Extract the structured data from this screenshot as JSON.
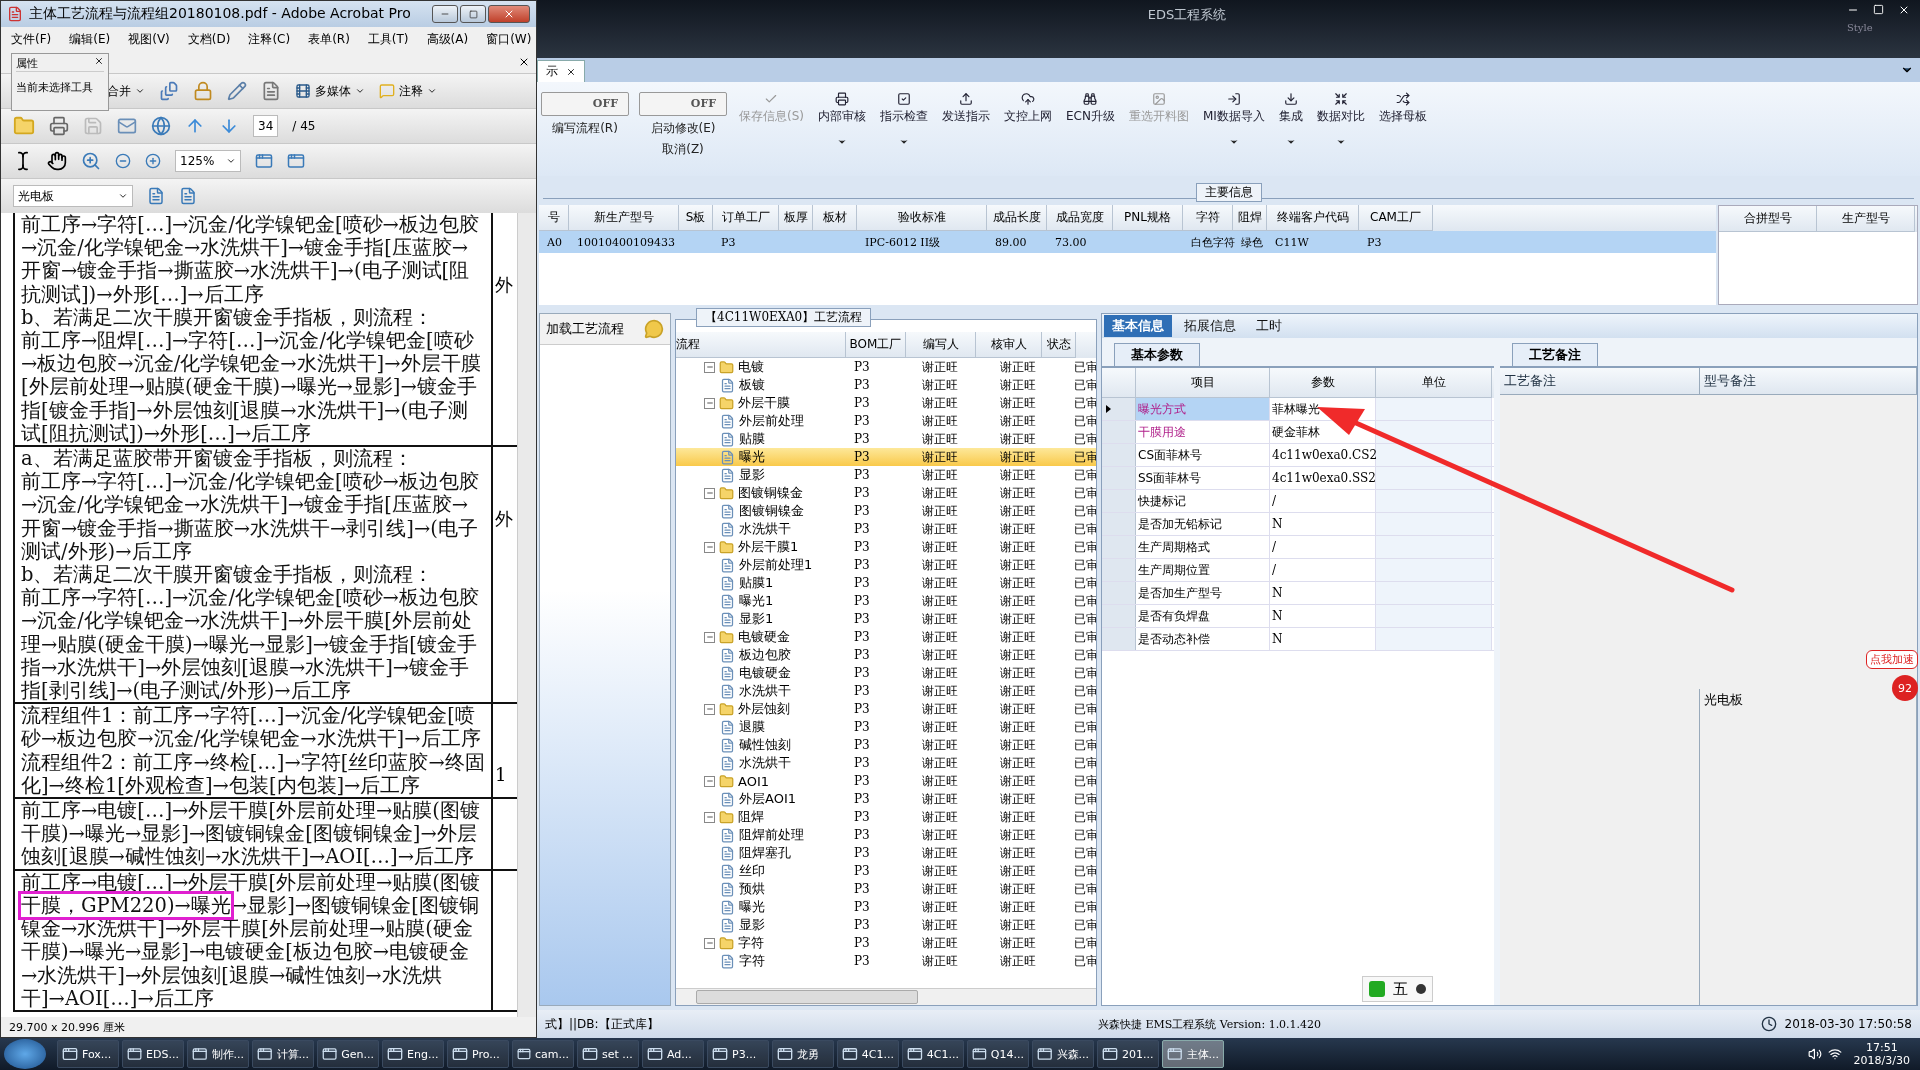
{
  "acrobat": {
    "title": "主体工艺流程与流程组20180108.pdf - Adobe Acrobat Pro",
    "menu": [
      "文件(F)",
      "编辑(E)",
      "视图(V)",
      "文档(D)",
      "注释(C)",
      "表单(R)",
      "工具(T)",
      "高级(A)",
      "窗口(W)"
    ],
    "properties_popup": {
      "title": "属性",
      "text": "当前未选择工具"
    },
    "toolbar_labels": [
      "合并",
      "多媒体",
      "注释"
    ],
    "page": {
      "current": "34",
      "total": "/ 45"
    },
    "zoom": "125%",
    "bookmark_field": "光电板",
    "document_rows": [
      {
        "paragraphs": [
          [
            {
              "text": "前工序→字符[…]→沉金/化学镍钯金[喷砂→板边包胶→沉金/化学镍钯金→水洗烘干]→镀金手指[压蓝胶→开窗→镀金手指→撕蓝胶→水洗烘干]→(电子测试[阻抗测试])→外形[…]→后工序",
              "highlighted": false
            }
          ],
          [
            {
              "text": "b、若满足二次干膜开窗镀金手指板，则流程：",
              "highlighted": false
            }
          ],
          [
            {
              "text": "前工序→阻焊[…]→字符[…]→沉金/化学镍钯金[喷砂→板边包胶→沉金/化学镍钯金→水洗烘干]→外层干膜[外层前处理→贴膜(硬金干膜)→曝光→显影]→镀金手指[镀金手指]→外层蚀刻[退膜→水洗烘干]→(电子测试[阻抗测试])→外形[…]→后工序",
              "highlighted": false
            }
          ]
        ],
        "column_2": "外"
      },
      {
        "paragraphs": [
          [
            {
              "text": "a、若满足蓝胶带开窗镀金手指板，则流程：",
              "highlighted": false
            }
          ],
          [
            {
              "text": "前工序→字符[…]→沉金/化学镍钯金[喷砂→板边包胶→沉金/化学镍钯金→水洗烘干]→镀金手指[压蓝胶→开窗→镀金手指→撕蓝胶→水洗烘干→剥引线]→(电子测试/外形)→后工序",
              "highlighted": false
            }
          ],
          [
            {
              "text": "b、若满足二次干膜开窗镀金手指板，则流程：",
              "highlighted": false
            }
          ],
          [
            {
              "text": "前工序→字符[…]→沉金/化学镍钯金[喷砂→板边包胶→沉金/化学镍钯金→水洗烘干]→外层干膜[外层前处理→贴膜(硬金干膜)→曝光→显影]→镀金手指[镀金手指→水洗烘干]→外层蚀刻[退膜→水洗烘干]→镀金手指[剥引线]→(电子测试/外形)→后工序",
              "highlighted": false
            }
          ]
        ],
        "column_2": "外"
      },
      {
        "paragraphs": [
          [
            {
              "text": "流程组件1：前工序→字符[…]→沉金/化学镍钯金[喷砂→板边包胶→沉金/化学镍钯金→水洗烘干]→后工序",
              "highlighted": false
            }
          ],
          [
            {
              "text": "流程组件2：前工序→终检[…]→字符[丝印蓝胶→终固化]→终检1[外观检查]→包装[内包装]→后工序",
              "highlighted": false
            }
          ]
        ],
        "column_2": "1"
      },
      {
        "paragraphs": [
          [
            {
              "text": "前工序→电镀[…]→外层干膜[外层前处理→贴膜(图镀干膜)→曝光→显影]→图镀铜镍金[图镀铜镍金]→外层蚀刻[退膜→碱性蚀刻→水洗烘干]→AOI[…]→后工序",
              "highlighted": false
            }
          ]
        ]
      },
      {
        "paragraphs": [
          [
            {
              "text": "前工序→电镀[…]→外层干膜[外层前处理→贴膜(图镀",
              "highlighted": false
            },
            {
              "text": "干膜，GPM220)→曝光",
              "highlighted": true
            },
            {
              "text": "→显影]→图镀铜镍金[图镀铜镍金→水洗烘干]→外层干膜[外层前处理→贴膜(硬金干膜)→曝光→显影]→电镀硬金[板边包胶→电镀硬金→水洗烘干]→外层蚀刻[退膜→碱性蚀刻→水洗烘干]→AOI[…]→后工序",
              "highlighted": false
            }
          ]
        ]
      }
    ],
    "status": "29.700 x 20.996 厘米"
  },
  "eds": {
    "title": "EDS工程系统",
    "style_label": "Style",
    "tab": "示",
    "toolbar": [
      {
        "kind": "toggle",
        "switch_label": "OFF",
        "on": false,
        "label": "编写流程(R)"
      },
      {
        "kind": "toggle",
        "switch_label": "OFF",
        "on": false,
        "label": "启动修改(E)",
        "label_2": "取消(Z)"
      },
      {
        "kind": "button",
        "label": "保存信息(S)",
        "disabled": true,
        "dropdown": false
      },
      {
        "kind": "button",
        "label": "内部审核",
        "disabled": false,
        "dropdown": true
      },
      {
        "kind": "button",
        "label": "指示检查",
        "disabled": false,
        "dropdown": true
      },
      {
        "kind": "button",
        "label": "发送指示",
        "disabled": false,
        "dropdown": false
      },
      {
        "kind": "button",
        "label": "文控上网",
        "disabled": false,
        "dropdown": false
      },
      {
        "kind": "button",
        "label": "ECN升级",
        "disabled": false,
        "dropdown": false
      },
      {
        "kind": "button",
        "label": "重选开料图",
        "disabled": true,
        "dropdown": false
      },
      {
        "kind": "button",
        "label": "MI数据导入",
        "disabled": false,
        "dropdown": true
      },
      {
        "kind": "button",
        "label": "集成",
        "disabled": false,
        "dropdown": true
      },
      {
        "kind": "button",
        "label": "数据对比",
        "disabled": false,
        "dropdown": true
      },
      {
        "kind": "button",
        "label": "选择母板",
        "disabled": false,
        "dropdown": false
      }
    ],
    "main_info": {
      "title": "主要信息",
      "columns": [
        "号",
        "新生产型号",
        "S板",
        "订单工厂",
        "板厚",
        "板材",
        "验收标准",
        "成品长度",
        "成品宽度",
        "PNL规格",
        "字符",
        "阻焊",
        "终端客户代码",
        "CAM工厂"
      ],
      "rows": [
        {
          "selected": true,
          "cells": [
            "A0",
            "10010400109433",
            null,
            "P3",
            null,
            null,
            "IPC-6012 II级",
            "89.00",
            "73.00",
            null,
            "白色字符",
            "绿色",
            "C11W",
            "P3"
          ]
        }
      ],
      "side_columns": [
        "合拼型号",
        "生产型号"
      ]
    },
    "side_panel": {
      "label": "加载工艺流程"
    },
    "flow": {
      "title": "【4C11W0EXA0】工艺流程",
      "columns": [
        "流程",
        "BOM工厂",
        "编写人",
        "核审人",
        "状态"
      ],
      "items": [
        {
          "name": "电镀",
          "bom": "P3",
          "writer": "谢正旺",
          "reviewer": "谢正旺",
          "status": "已审",
          "selected": false,
          "expanded": true,
          "children": [
            {
              "name": "板镀",
              "bom": "P3",
              "writer": "谢正旺",
              "reviewer": "谢正旺",
              "status": "已审",
              "selected": false
            }
          ]
        },
        {
          "name": "外层干膜",
          "bom": "P3",
          "writer": "谢正旺",
          "reviewer": "谢正旺",
          "status": "已审",
          "selected": false,
          "expanded": true,
          "children": [
            {
              "name": "外层前处理",
              "bom": "P3",
              "writer": "谢正旺",
              "reviewer": "谢正旺",
              "status": "已审",
              "selected": false
            },
            {
              "name": "贴膜",
              "bom": "P3",
              "writer": "谢正旺",
              "reviewer": "谢正旺",
              "status": "已审",
              "selected": false
            },
            {
              "name": "曝光",
              "bom": "P3",
              "writer": "谢正旺",
              "reviewer": "谢正旺",
              "status": "已审",
              "selected": true
            },
            {
              "name": "显影",
              "bom": "P3",
              "writer": "谢正旺",
              "reviewer": "谢正旺",
              "status": "已审",
              "selected": false
            }
          ]
        },
        {
          "name": "图镀铜镍金",
          "bom": "P3",
          "writer": "谢正旺",
          "reviewer": "谢正旺",
          "status": "已审",
          "selected": false,
          "expanded": true,
          "children": [
            {
              "name": "图镀铜镍金",
              "bom": "P3",
              "writer": "谢正旺",
              "reviewer": "谢正旺",
              "status": "已审",
              "selected": false
            },
            {
              "name": "水洗烘干",
              "bom": "P3",
              "writer": "谢正旺",
              "reviewer": "谢正旺",
              "status": "已审",
              "selected": false
            }
          ]
        },
        {
          "name": "外层干膜1",
          "bom": "P3",
          "writer": "谢正旺",
          "reviewer": "谢正旺",
          "status": "已审",
          "selected": false,
          "expanded": true,
          "children": [
            {
              "name": "外层前处理1",
              "bom": "P3",
              "writer": "谢正旺",
              "reviewer": "谢正旺",
              "status": "已审",
              "selected": false
            },
            {
              "name": "贴膜1",
              "bom": "P3",
              "writer": "谢正旺",
              "reviewer": "谢正旺",
              "status": "已审",
              "selected": false
            },
            {
              "name": "曝光1",
              "bom": "P3",
              "writer": "谢正旺",
              "reviewer": "谢正旺",
              "status": "已审",
              "selected": false
            },
            {
              "name": "显影1",
              "bom": "P3",
              "writer": "谢正旺",
              "reviewer": "谢正旺",
              "status": "已审",
              "selected": false
            }
          ]
        },
        {
          "name": "电镀硬金",
          "bom": "P3",
          "writer": "谢正旺",
          "reviewer": "谢正旺",
          "status": "已审",
          "selected": false,
          "expanded": true,
          "children": [
            {
              "name": "板边包胶",
              "bom": "P3",
              "writer": "谢正旺",
              "reviewer": "谢正旺",
              "status": "已审",
              "selected": false
            },
            {
              "name": "电镀硬金",
              "bom": "P3",
              "writer": "谢正旺",
              "reviewer": "谢正旺",
              "status": "已审",
              "selected": false
            },
            {
              "name": "水洗烘干",
              "bom": "P3",
              "writer": "谢正旺",
              "reviewer": "谢正旺",
              "status": "已审",
              "selected": false
            }
          ]
        },
        {
          "name": "外层蚀刻",
          "bom": "P3",
          "writer": "谢正旺",
          "reviewer": "谢正旺",
          "status": "已审",
          "selected": false,
          "expanded": true,
          "children": [
            {
              "name": "退膜",
              "bom": "P3",
              "writer": "谢正旺",
              "reviewer": "谢正旺",
              "status": "已审",
              "selected": false
            },
            {
              "name": "碱性蚀刻",
              "bom": "P3",
              "writer": "谢正旺",
              "reviewer": "谢正旺",
              "status": "已审",
              "selected": false
            },
            {
              "name": "水洗烘干",
              "bom": "P3",
              "writer": "谢正旺",
              "reviewer": "谢正旺",
              "status": "已审",
              "selected": false
            }
          ]
        },
        {
          "name": "AOI1",
          "bom": "P3",
          "writer": "谢正旺",
          "reviewer": "谢正旺",
          "status": "已审",
          "selected": false,
          "expanded": true,
          "children": [
            {
              "name": "外层AOI1",
              "bom": "P3",
              "writer": "谢正旺",
              "reviewer": "谢正旺",
              "status": "已审",
              "selected": false
            }
          ]
        },
        {
          "name": "阻焊",
          "bom": "P3",
          "writer": "谢正旺",
          "reviewer": "谢正旺",
          "status": "已审",
          "selected": false,
          "expanded": true,
          "children": [
            {
              "name": "阻焊前处理",
              "bom": "P3",
              "writer": "谢正旺",
              "reviewer": "谢正旺",
              "status": "已审",
              "selected": false
            },
            {
              "name": "阻焊塞孔",
              "bom": "P3",
              "writer": "谢正旺",
              "reviewer": "谢正旺",
              "status": "已审",
              "selected": false
            },
            {
              "name": "丝印",
              "bom": "P3",
              "writer": "谢正旺",
              "reviewer": "谢正旺",
              "status": "已审",
              "selected": false
            },
            {
              "name": "预烘",
              "bom": "P3",
              "writer": "谢正旺",
              "reviewer": "谢正旺",
              "status": "已审",
              "selected": false
            },
            {
              "name": "曝光",
              "bom": "P3",
              "writer": "谢正旺",
              "reviewer": "谢正旺",
              "status": "已审",
              "selected": false
            },
            {
              "name": "显影",
              "bom": "P3",
              "writer": "谢正旺",
              "reviewer": "谢正旺",
              "status": "已审",
              "selected": false
            }
          ]
        },
        {
          "name": "字符",
          "bom": "P3",
          "writer": "谢正旺",
          "reviewer": "谢正旺",
          "status": "已审",
          "selected": false,
          "expanded": true,
          "children": [
            {
              "name": "字符",
              "bom": "P3",
              "writer": "谢正旺",
              "reviewer": "谢正旺",
              "status": "已审",
              "selected": false
            }
          ]
        }
      ]
    },
    "detail": {
      "tabs": [
        {
          "label": "基本信息",
          "selected": true
        },
        {
          "label": "拓展信息",
          "selected": false
        },
        {
          "label": "工时",
          "selected": false
        }
      ],
      "params": {
        "tab": "基本参数",
        "columns": [
          "项目",
          "参数",
          "单位"
        ],
        "rows": [
          {
            "item": "曝光方式",
            "value": "菲林曝光",
            "emphasized": true,
            "selected": true
          },
          {
            "item": "干膜用途",
            "value": "硬金菲林",
            "emphasized": true,
            "selected": false
          },
          {
            "item": "CS面菲林号",
            "value": "4c11w0exa0.CS2",
            "emphasized": false,
            "selected": false
          },
          {
            "item": "SS面菲林号",
            "value": "4c11w0exa0.SS2",
            "emphasized": false,
            "selected": false
          },
          {
            "item": "快捷标记",
            "value": "/",
            "emphasized": false,
            "selected": false
          },
          {
            "item": "是否加无铅标记",
            "value": "N",
            "emphasized": false,
            "selected": false
          },
          {
            "item": "生产周期格式",
            "value": "/",
            "emphasized": false,
            "selected": false
          },
          {
            "item": "生产周期位置",
            "value": "/",
            "emphasized": false,
            "selected": false
          },
          {
            "item": "是否加生产型号",
            "value": "N",
            "emphasized": false,
            "selected": false
          },
          {
            "item": "是否有负焊盘",
            "value": "N",
            "emphasized": false,
            "selected": false
          },
          {
            "item": "是否动态补偿",
            "value": "N",
            "emphasized": false,
            "selected": false
          }
        ]
      },
      "notes": {
        "tab": "工艺备注",
        "columns": [
          "工艺备注",
          "型号备注"
        ],
        "model_note": "光电板"
      }
    },
    "ime_bar": {
      "label": "五"
    },
    "badge": {
      "label": "点我加速",
      "count": "92"
    },
    "status": {
      "left": "式】||DB:【正式库】",
      "center": "兴森快捷 EMS工程系统 Version: 1.0.1.420",
      "datetime": "2018-03-30 17:50:58"
    }
  },
  "taskbar": {
    "items": [
      {
        "label": "Fox...",
        "selected": false
      },
      {
        "label": "EDS...",
        "selected": false
      },
      {
        "label": "制作...",
        "selected": false
      },
      {
        "label": "计算...",
        "selected": false
      },
      {
        "label": "Gen...",
        "selected": false
      },
      {
        "label": "Eng...",
        "selected": false
      },
      {
        "label": "Pro...",
        "selected": false
      },
      {
        "label": "cam...",
        "selected": false
      },
      {
        "label": "set ...",
        "selected": false
      },
      {
        "label": "Ad...",
        "selected": false
      },
      {
        "label": "P3...",
        "selected": false
      },
      {
        "label": "龙勇",
        "selected": false
      },
      {
        "label": "4C1...",
        "selected": false
      },
      {
        "label": "4C1...",
        "selected": false
      },
      {
        "label": "Q14...",
        "selected": false
      },
      {
        "label": "兴森...",
        "selected": false
      },
      {
        "label": "201...",
        "selected": false
      },
      {
        "label": "主体...",
        "selected": true
      }
    ],
    "time": "17:51",
    "date": "2018/3/30"
  }
}
